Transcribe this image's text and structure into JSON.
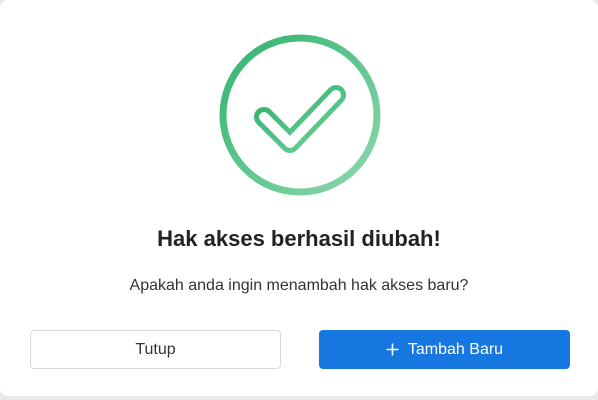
{
  "dialog": {
    "title": "Hak akses berhasil diubah!",
    "message": "Apakah anda ingin menambah hak akses baru?",
    "icon": "check-circle-icon",
    "accent_color": "#3dbb7a",
    "buttons": {
      "close_label": "Tutup",
      "add_label": "Tambah Baru",
      "add_icon": "plus-icon",
      "primary_color": "#1677e0"
    }
  }
}
